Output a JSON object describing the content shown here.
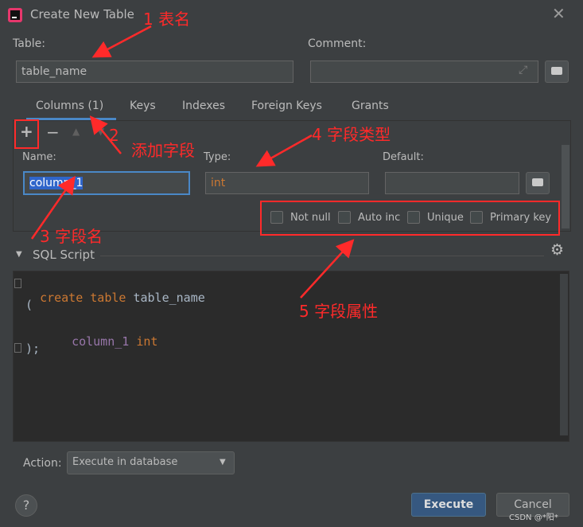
{
  "window": {
    "title": "Create New Table",
    "app_icon": "intellij-icon"
  },
  "labels": {
    "table": "Table:",
    "comment": "Comment:"
  },
  "inputs": {
    "table_name": "table_name",
    "comment": ""
  },
  "tabs": [
    {
      "label": "Columns (1)",
      "active": true
    },
    {
      "label": "Keys"
    },
    {
      "label": "Indexes"
    },
    {
      "label": "Foreign Keys"
    },
    {
      "label": "Grants"
    }
  ],
  "toolbar": {
    "add": "+",
    "remove": "−"
  },
  "column_editor": {
    "name_label": "Name:",
    "name_value": "column_1",
    "type_label": "Type:",
    "type_value": "int",
    "default_label": "Default:",
    "default_value": ""
  },
  "checkboxes": {
    "not_null": "Not null",
    "auto_inc": "Auto inc",
    "unique": "Unique",
    "primary_key": "Primary key"
  },
  "sql": {
    "title": "SQL Script",
    "line1_kw": "create table",
    "line1_name": "table_name",
    "line2": "(",
    "line3_col": "column_1",
    "line3_type": "int",
    "line4": ");"
  },
  "footer": {
    "action_label": "Action:",
    "action_value": "Execute in database",
    "execute": "Execute",
    "cancel": "Cancel",
    "help": "?"
  },
  "annotations": {
    "a1": "1 表名",
    "a2": "2",
    "a2_text": "添加字段",
    "a3": "3 字段名",
    "a4": "4 字段类型",
    "a5": "5 字段属性"
  },
  "watermark": "CSDN @*阳*",
  "colors": {
    "keyword": "#cc7832",
    "identifier": "#9876aa",
    "accent": "#4a88c7",
    "annotation": "#ff2a2a",
    "execute": "#365880"
  }
}
